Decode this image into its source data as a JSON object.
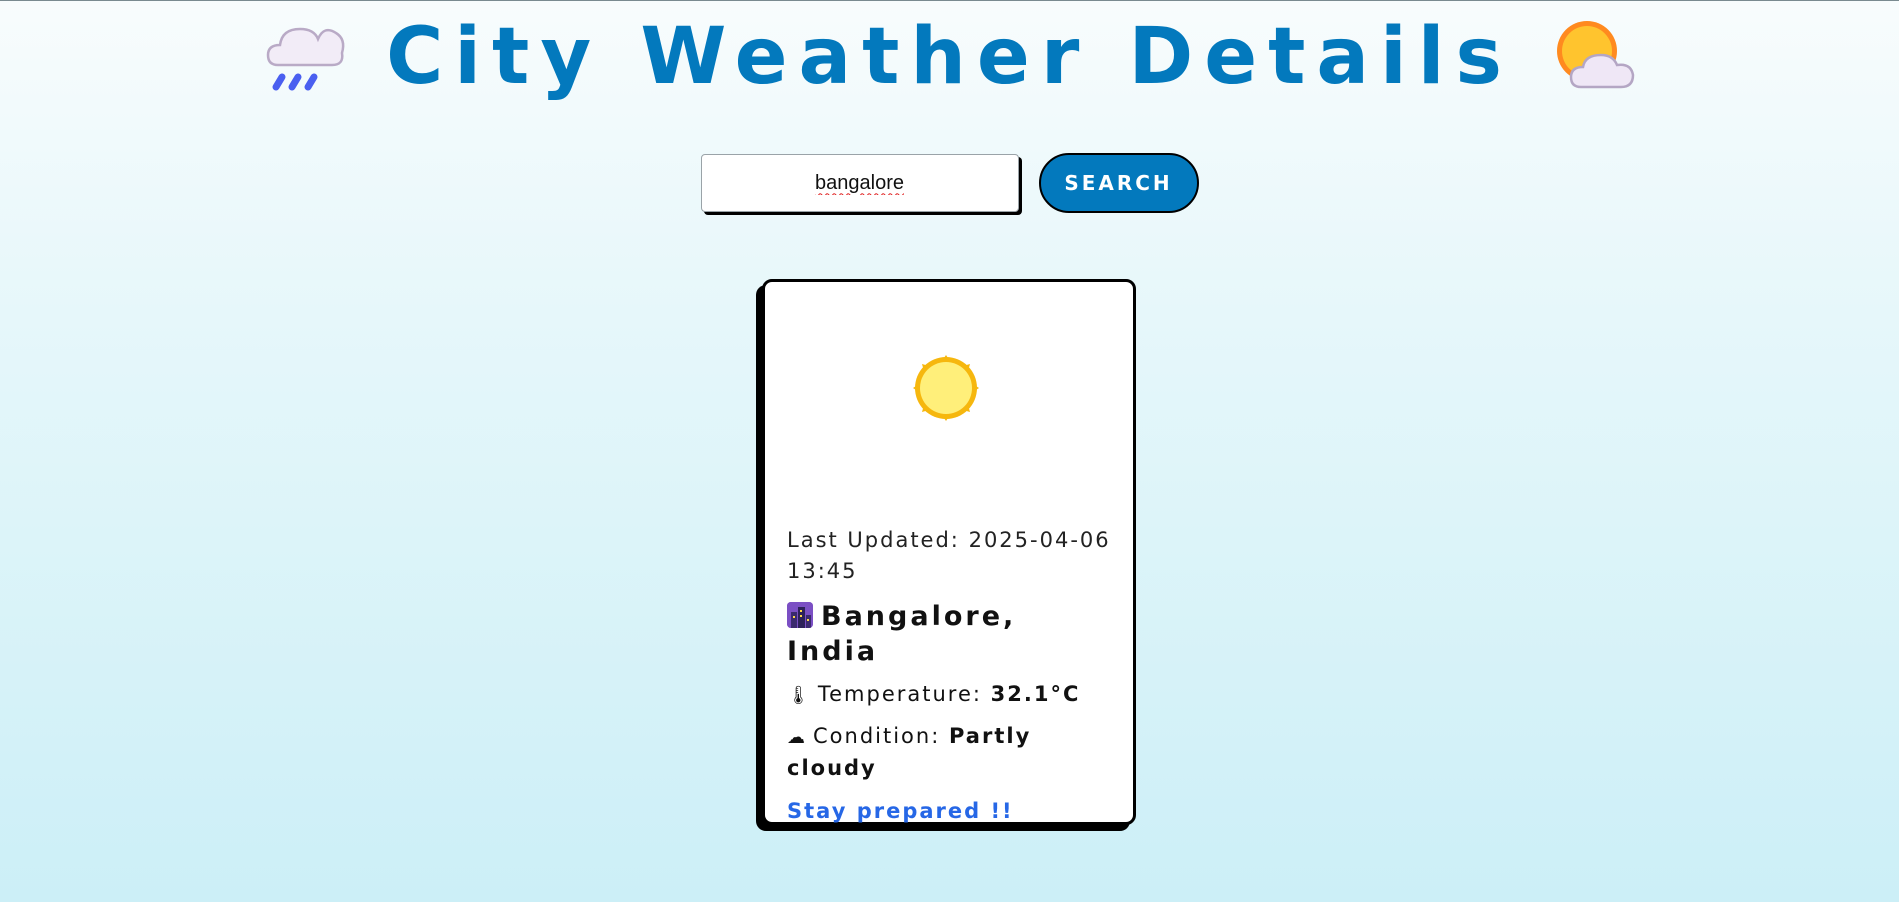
{
  "header": {
    "title": "City Weather Details",
    "left_icon": "cloud-with-rain-icon",
    "right_icon": "sun-behind-cloud-icon"
  },
  "search": {
    "value": "bangalore",
    "placeholder": "",
    "button_label": "SEARCH"
  },
  "card": {
    "weather_icon": "sun-icon",
    "last_updated_label": "Last Updated:",
    "last_updated_value": "2025-04-06 13:45",
    "location_icon": "cityscape-icon",
    "location": "Bangalore, India",
    "temperature_icon": "thermometer-icon",
    "temperature_label": "Temperature:",
    "temperature_value": "32.1°C",
    "condition_icon": "cloud-icon",
    "condition_label": "Condition:",
    "condition_value": "Partly cloudy",
    "tagline": "Stay prepared !!"
  },
  "colors": {
    "accent": "#0379bd",
    "tagline": "#2667e6"
  }
}
